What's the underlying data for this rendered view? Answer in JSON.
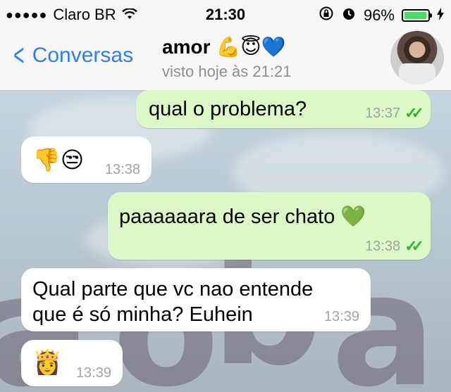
{
  "status_bar": {
    "signal": "●●●●●",
    "carrier": "Claro BR",
    "time": "21:30",
    "battery_percent": "96%",
    "battery_level": 0.96
  },
  "nav": {
    "back_label": "Conversas",
    "contact_name": "amor",
    "contact_emojis": "💪😇💙",
    "last_seen": "visto hoje às 21:21"
  },
  "messages": [
    {
      "direction": "outgoing",
      "text": "qual o problema?",
      "time": "13:37",
      "read": true
    },
    {
      "direction": "incoming",
      "text": "👎😒",
      "time": "13:38"
    },
    {
      "direction": "outgoing",
      "text": "paaaaaara de ser chato 💚",
      "time": "13:38",
      "read": true
    },
    {
      "direction": "incoming",
      "text_line1": "Qual parte que vc nao entende",
      "text_line2": "que é só minha? Euhein",
      "time": "13:39"
    },
    {
      "direction": "incoming",
      "text": "👸",
      "time": "13:39"
    }
  ],
  "colors": {
    "outgoing_bubble": "#dcf8c6",
    "incoming_bubble": "#ffffff",
    "accent": "#2d7df6",
    "read_ticks": "#34b233"
  }
}
